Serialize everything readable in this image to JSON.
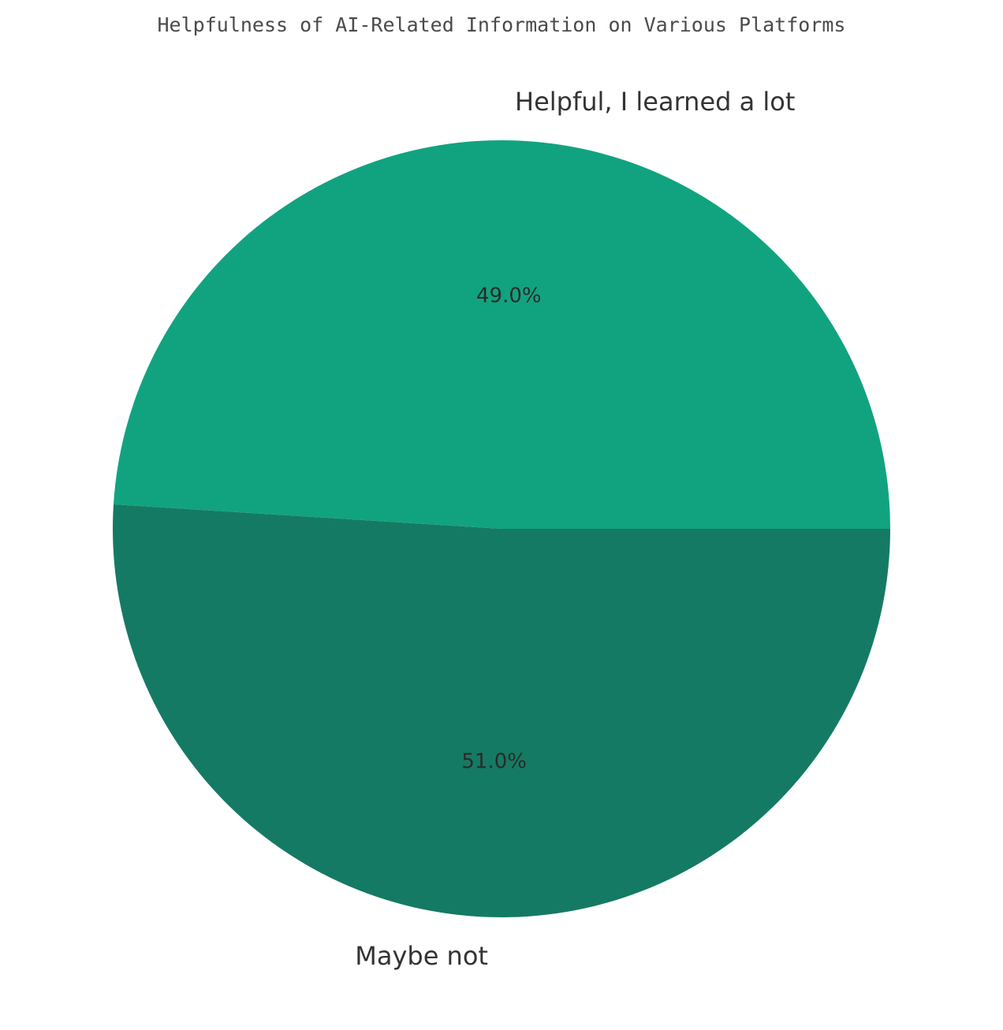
{
  "chart_data": {
    "type": "pie",
    "title": "Helpfulness of AI-Related Information on Various Platforms",
    "slices": [
      {
        "label": "Helpful, I learned a lot",
        "value": 49.0,
        "pct_label": "49.0%",
        "color": "#11a37f"
      },
      {
        "label": "Maybe not",
        "value": 51.0,
        "pct_label": "51.0%",
        "color": "#157a63"
      }
    ],
    "start_angle_deg": 0,
    "direction": "counterclockwise",
    "legend": "none"
  }
}
